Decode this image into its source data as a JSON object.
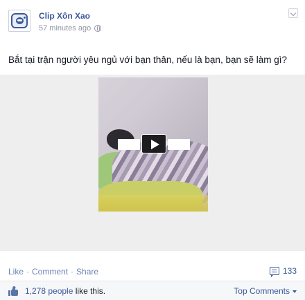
{
  "post": {
    "author": "Clip Xôn Xao",
    "time": "57 minutes ago",
    "privacy_icon": "globe-icon",
    "status_text": "Bắt tại trận người yêu ngủ với bạn thân, nếu là bạn, bạn sẽ làm gì?"
  },
  "video": {
    "play_icon": "play-icon"
  },
  "actions": {
    "like": "Like",
    "comment": "Comment",
    "share": "Share",
    "separator": "·",
    "comment_count": "133"
  },
  "likes": {
    "count_label": "1,278 people",
    "suffix": " like this.",
    "sort_label": "Top Comments"
  },
  "colors": {
    "brand": "#3b5998",
    "link": "#6d84b4",
    "muted": "#9197a3"
  }
}
